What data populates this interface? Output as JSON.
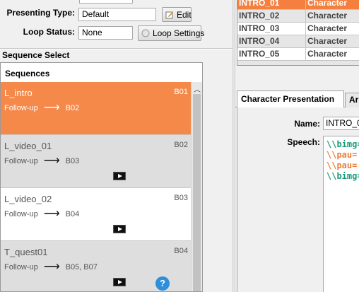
{
  "form": {
    "presenting_type_label": "Presenting Type:",
    "presenting_type_value": "Default",
    "edit_label": "Edit",
    "loop_status_label": "Loop Status:",
    "loop_status_value": "None",
    "loop_settings_label": "Loop Settings"
  },
  "sequence_select": {
    "title": "Sequence Select",
    "list_header": "Sequences",
    "items": [
      {
        "name": "L_intro",
        "code": "B01",
        "follow_label": "Follow-up",
        "follow_target": "B02",
        "has_video": false,
        "selected": true
      },
      {
        "name": "L_video_01",
        "code": "B02",
        "follow_label": "Follow-up",
        "follow_target": "B03",
        "has_video": true,
        "selected": false
      },
      {
        "name": "L_video_02",
        "code": "B03",
        "follow_label": "Follow-up",
        "follow_target": "B04",
        "has_video": true,
        "selected": false
      },
      {
        "name": "T_quest01",
        "code": "B04",
        "follow_label": "Follow-up",
        "follow_target": "B05, B07",
        "has_video": true,
        "selected": false
      }
    ]
  },
  "table": {
    "rows": [
      {
        "id": "INTRO_01",
        "type": "Character",
        "selected": true
      },
      {
        "id": "INTRO_02",
        "type": "Character",
        "selected": false
      },
      {
        "id": "INTRO_03",
        "type": "Character",
        "selected": false
      },
      {
        "id": "INTRO_04",
        "type": "Character",
        "selected": false
      },
      {
        "id": "INTRO_05",
        "type": "Character",
        "selected": false
      }
    ]
  },
  "tabs": {
    "active": "Character Presentation",
    "next": "Ar"
  },
  "detail": {
    "name_label": "Name:",
    "name_value": "INTRO_01",
    "speech_label": "Speech:",
    "speech_lines": [
      {
        "text": "\\\\bimg=",
        "color": "#1a9a7a"
      },
      {
        "text": "\\\\pau=",
        "color": "#e8803a"
      },
      {
        "text": "\\\\pau=",
        "color": "#e8803a"
      },
      {
        "text": "\\\\bimg=",
        "color": "#1a9a7a"
      }
    ]
  },
  "colors": {
    "accent": "#f5894a",
    "selected_row": "#f47f3f",
    "help": "#2f8fd8"
  },
  "icons": {
    "edit": "edit-icon",
    "loop": "loop-settings-icon",
    "play": "play-icon",
    "help": "help-icon",
    "arrow": "right-arrow-icon"
  }
}
